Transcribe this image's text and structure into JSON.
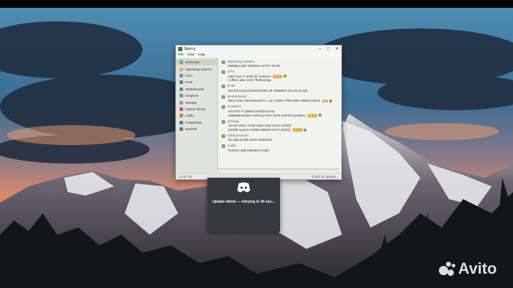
{
  "speccy": {
    "window_title": "Speccy",
    "menu": [
      "File",
      "View",
      "Help"
    ],
    "sidebar": [
      {
        "label": "Summary",
        "icon": "summary-icon",
        "color": "#7aa868"
      },
      {
        "label": "Operating System",
        "icon": "windows-icon",
        "color": "#e0b040"
      },
      {
        "label": "CPU",
        "icon": "cpu-icon",
        "color": "#6f8fbf"
      },
      {
        "label": "RAM",
        "icon": "ram-icon",
        "color": "#4e9a57"
      },
      {
        "label": "Motherboard",
        "icon": "motherboard-icon",
        "color": "#8a6fb0"
      },
      {
        "label": "Graphics",
        "icon": "graphics-icon",
        "color": "#4ea0b0"
      },
      {
        "label": "Storage",
        "icon": "storage-icon",
        "color": "#9a9a9a"
      },
      {
        "label": "Optical Drives",
        "icon": "optical-drive-icon",
        "color": "#c45a4a"
      },
      {
        "label": "Audio",
        "icon": "audio-icon",
        "color": "#e07a30"
      },
      {
        "label": "Peripherals",
        "icon": "peripherals-icon",
        "color": "#5a7ab0"
      },
      {
        "label": "Network",
        "icon": "network-icon",
        "color": "#3f8f3f"
      }
    ],
    "sections": [
      {
        "title": "Operating System",
        "lines": [
          {
            "text": "Майкрософт Windows 10 Pro 64-bit"
          }
        ]
      },
      {
        "title": "CPU",
        "lines": [
          {
            "text": "Intel Core i7 9700 @ 3.00GHz",
            "temp": "35 °C"
          },
          {
            "text": "Coffee Lake 14nm Technology"
          }
        ]
      },
      {
        "title": "RAM",
        "lines": [
          {
            "text": "16,0ГБ Dual-Channel DDR4 @ 1066MHz (15-15-15-36)"
          }
        ]
      },
      {
        "title": "Motherboard",
        "lines": [
          {
            "text": "Micro-Star International Co. Ltd. Z390-A PRO (MS-7B98) (U3E1)",
            "temp": "33"
          }
        ]
      },
      {
        "title": "Graphics",
        "lines": [
          {
            "text": "VG270U P (2560x1440@144Hz)"
          },
          {
            "text": "4095MB NVIDIA GeForce RTX 2070 SUPER (NVIDIA)",
            "temp": "46 °C"
          }
        ]
      },
      {
        "title": "Storage",
        "lines": [
          {
            "text": "111GB SPCC Solid State Disk (SATA (SSD))"
          },
          {
            "text": "238GB Apacer AS350 256GB (SATA (SSD))",
            "temp": "40 °C"
          }
        ]
      },
      {
        "title": "Optical Drives",
        "lines": [
          {
            "text": "No optical disk drives detected"
          }
        ]
      },
      {
        "title": "Audio",
        "lines": [
          {
            "text": "NVIDIA High Definition Audio"
          }
        ]
      }
    ],
    "status_left": "v1.32.740",
    "status_right": "Check for updates..."
  },
  "discord": {
    "message": "Update failed — retrying in 30 sec..."
  },
  "watermark": {
    "text": "Avito"
  }
}
